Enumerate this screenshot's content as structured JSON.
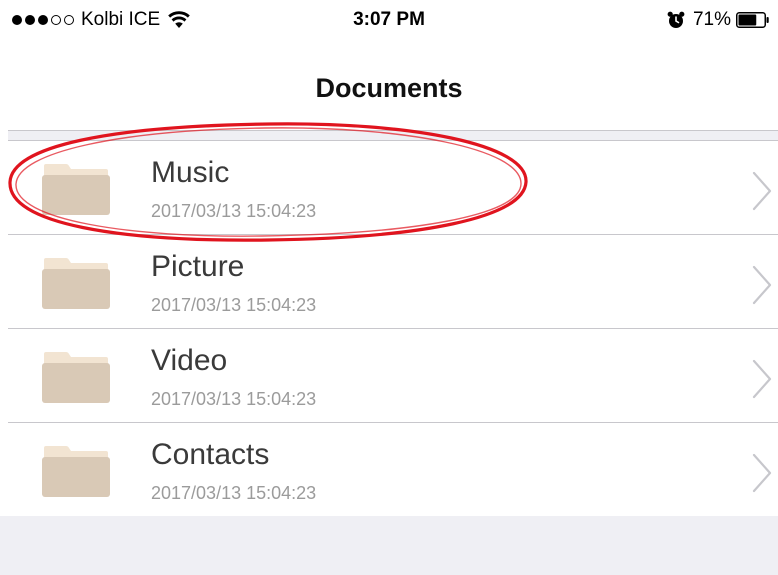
{
  "status_bar": {
    "carrier": "Kolbi ICE",
    "signal_filled": 3,
    "signal_total": 5,
    "time": "3:07 PM",
    "battery_percent": "71%",
    "battery_level": 0.71,
    "icons": [
      "wifi-icon",
      "alarm-icon",
      "battery-icon"
    ]
  },
  "nav": {
    "title": "Documents"
  },
  "folders": [
    {
      "name": "Music",
      "date": "2017/03/13 15:04:23"
    },
    {
      "name": "Picture",
      "date": "2017/03/13 15:04:23"
    },
    {
      "name": "Video",
      "date": "2017/03/13 15:04:23"
    },
    {
      "name": "Contacts",
      "date": "2017/03/13 15:04:23"
    }
  ],
  "colors": {
    "folder_body": "#d9c9b6",
    "folder_tab": "#f2e4d2",
    "annotation_red": "#e0141e",
    "separator": "#c8c7cc",
    "group_background": "#efeff4"
  },
  "annotation": {
    "highlighted_item": "Music"
  }
}
